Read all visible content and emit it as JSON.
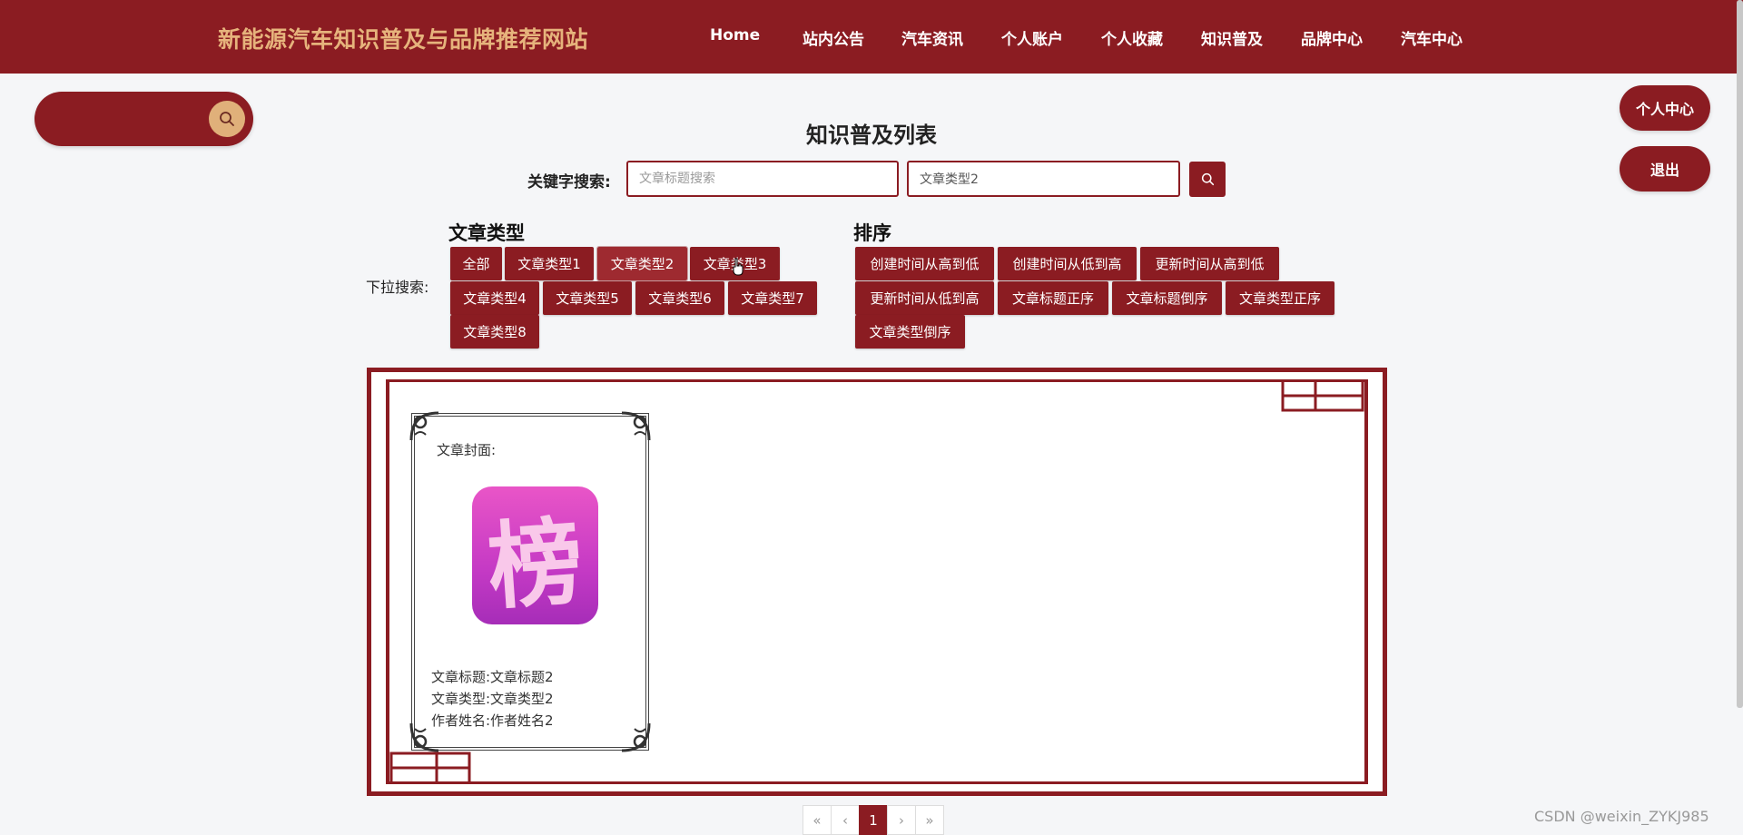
{
  "header": {
    "site_title": "新能源汽车知识普及与品牌推荐网站",
    "nav": [
      "Home",
      "站内公告",
      "汽车资讯",
      "个人账户",
      "个人收藏",
      "知识普及",
      "品牌中心",
      "汽车中心"
    ]
  },
  "side_buttons": {
    "profile": "个人中心",
    "logout": "退出"
  },
  "page": {
    "title": "知识普及列表",
    "keyword_label": "关键字搜索:",
    "title_search_placeholder": "文章标题搜索",
    "type_search_value": "文章类型2"
  },
  "filters": {
    "dropdown_label": "下拉搜索:",
    "type_group_title": "文章类型",
    "types": [
      "全部",
      "文章类型1",
      "文章类型2",
      "文章类型3",
      "文章类型4",
      "文章类型5",
      "文章类型6",
      "文章类型7",
      "文章类型8"
    ],
    "sort_group_title": "排序",
    "sorts": [
      "创建时间从高到低",
      "创建时间从低到高",
      "更新时间从高到低",
      "更新时间从低到高",
      "文章标题正序",
      "文章标题倒序",
      "文章类型正序",
      "文章类型倒序"
    ]
  },
  "card": {
    "cover_label": "文章封面:",
    "cover_glyph": "榜",
    "title_line": "文章标题:文章标题2",
    "type_line": "文章类型:文章类型2",
    "author_line": "作者姓名:作者姓名2"
  },
  "pagination": {
    "first": "«",
    "prev": "‹",
    "current": "1",
    "next": "›",
    "last": "»"
  },
  "watermark": "CSDN @weixin_ZYKJ985",
  "colors": {
    "primary": "#8b1c22",
    "title_gold": "#e6b37c",
    "search_btn": "#e0b07a"
  }
}
